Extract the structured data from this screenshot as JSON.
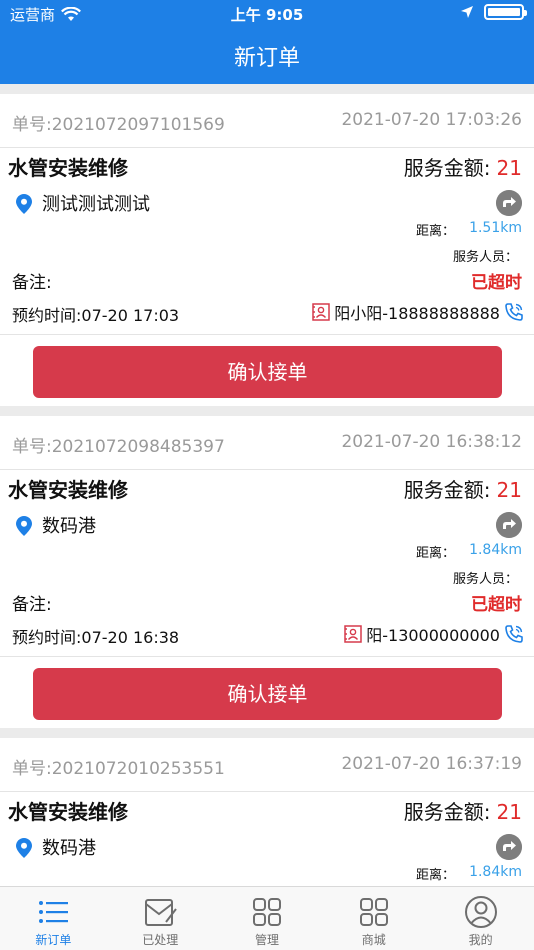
{
  "status_bar": {
    "carrier": "运营商",
    "time": "上午 9:05"
  },
  "nav": {
    "title": "新订单"
  },
  "labels": {
    "amount_label": "服务金额:",
    "distance_label": "距离：",
    "staff_label": "服务人员：",
    "remark_label": "备注:",
    "timeout": "已超时",
    "confirm": "确认接单"
  },
  "orders": [
    {
      "order_no": "单号:2021072097101569",
      "created": "2021-07-20 17:03:26",
      "service": "水管安装维修",
      "amount": "21",
      "address": "测试测试测试",
      "distance": "1.51km",
      "appointment": "预约时间:07-20 17:03",
      "contact": "阳小阳-18888888888"
    },
    {
      "order_no": "单号:2021072098485397",
      "created": "2021-07-20 16:38:12",
      "service": "水管安装维修",
      "amount": "21",
      "address": "数码港",
      "distance": "1.84km",
      "appointment": "预约时间:07-20 16:38",
      "contact": "阳-13000000000"
    },
    {
      "order_no": "单号:2021072010253551",
      "created": "2021-07-20 16:37:19",
      "service": "水管安装维修",
      "amount": "21",
      "address": "数码港",
      "distance": "1.84km"
    }
  ],
  "tabs": [
    {
      "label": "新订单",
      "icon": "list-icon",
      "active": true
    },
    {
      "label": "已处理",
      "icon": "processed-icon",
      "active": false
    },
    {
      "label": "管理",
      "icon": "grid-icon",
      "active": false
    },
    {
      "label": "商城",
      "icon": "store-icon",
      "active": false
    },
    {
      "label": "我的",
      "icon": "profile-icon",
      "active": false
    }
  ],
  "colors": {
    "primary": "#1e80e6",
    "danger": "#e02b2b",
    "button": "#d63a4b",
    "distance": "#3aa1e8"
  }
}
